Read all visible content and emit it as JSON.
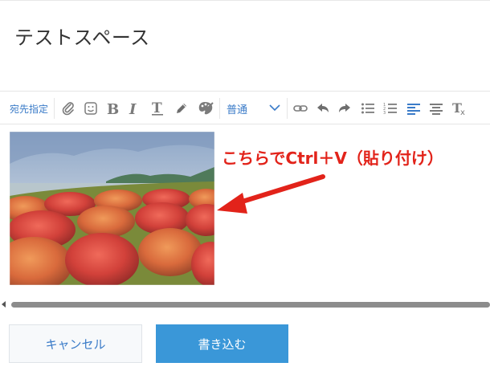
{
  "title": "テストスペース",
  "toolbar": {
    "recipient_label": "宛先指定",
    "style_select_value": "普通",
    "icons": [
      "attachment-icon",
      "emoji-icon",
      "bold-icon",
      "italic-icon",
      "text-underline-icon",
      "pen-icon",
      "palette-icon",
      "style-select",
      "link-icon",
      "undo-icon",
      "redo-icon",
      "bulleted-list-icon",
      "numbered-list-icon",
      "align-left-icon",
      "align-center-icon",
      "clear-format-icon"
    ]
  },
  "annotation": {
    "text": "こちらでCtrl＋V（貼り付け）",
    "color": "#e2231a"
  },
  "buttons": {
    "cancel_label": "キャンセル",
    "submit_label": "書き込む"
  },
  "colors": {
    "accent": "#3a7bc8",
    "primary_button": "#3a97d8"
  }
}
